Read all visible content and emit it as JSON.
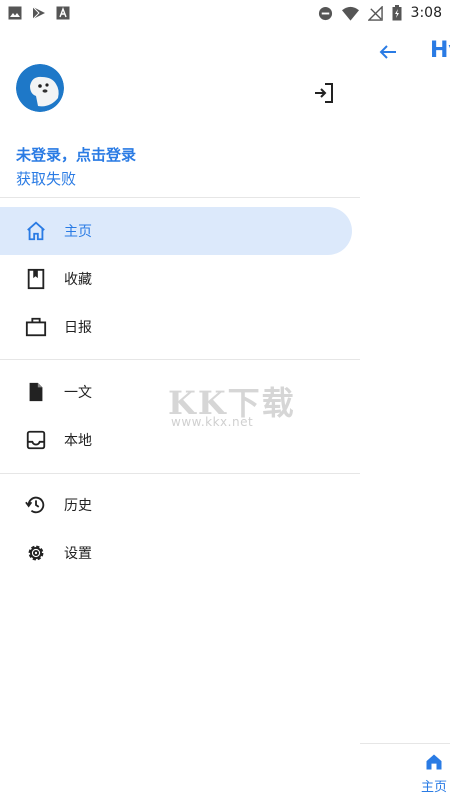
{
  "status_bar": {
    "time": "3:08",
    "left_icons": [
      "image-icon",
      "play-store-icon",
      "font-icon"
    ],
    "right_icons": [
      "do-not-disturb-icon",
      "wifi-icon",
      "no-signal-icon",
      "battery-charging-icon"
    ]
  },
  "background_app": {
    "title": "Hy",
    "bottom_nav_home_label": "主页"
  },
  "drawer": {
    "login_prompt": "未登录，点击登录",
    "fetch_status": "获取失败",
    "nav_items": [
      {
        "label": "主页",
        "icon": "home-icon",
        "active": true
      },
      {
        "label": "收藏",
        "icon": "bookmark-icon",
        "active": false
      },
      {
        "label": "日报",
        "icon": "briefcase-icon",
        "active": false
      },
      {
        "label": "一文",
        "icon": "document-icon",
        "active": false
      },
      {
        "label": "本地",
        "icon": "inbox-icon",
        "active": false
      },
      {
        "label": "历史",
        "icon": "history-icon",
        "active": false
      },
      {
        "label": "设置",
        "icon": "settings-icon",
        "active": false
      }
    ]
  },
  "watermark": {
    "text": "KK下载",
    "url": "www.kkx.net"
  },
  "colors": {
    "accent": "#2a7be4",
    "active_bg": "#dce9fb",
    "divider": "#e6e6e6"
  }
}
